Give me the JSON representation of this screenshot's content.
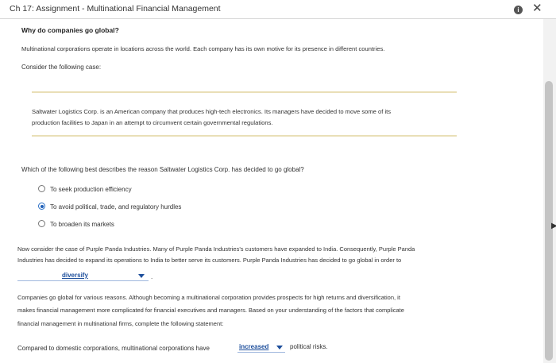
{
  "window": {
    "title": "Ch 17: Assignment - Multinational Financial Management"
  },
  "section": {
    "heading": "Why do companies go global?",
    "intro": "Multinational corporations operate in locations across the world. Each company has its own motive for its presence in different countries.",
    "consider": "Consider the following case:"
  },
  "case": {
    "line1": "Saltwater Logistics Corp. is an American company that produces high-tech electronics. Its managers have decided to move some of its",
    "line2": "production facilities to Japan in an attempt to circumvent certain governmental regulations."
  },
  "question1": {
    "prompt": "Which of the following best describes the reason Saltwater Logistics Corp. has decided to go global?",
    "options": [
      {
        "label": "To seek production efficiency",
        "selected": false
      },
      {
        "label": "To avoid political, trade, and regulatory hurdles",
        "selected": true
      },
      {
        "label": "To broaden its markets",
        "selected": false
      }
    ]
  },
  "question2": {
    "line1": "Now consider the case of Purple Panda Industries. Many of Purple Panda Industries's customers have expanded to India. Consequently, Purple Panda",
    "line2": "Industries has decided to expand its operations to India to better serve its customers. Purple Panda Industries has decided to go global in order to",
    "dropdown_value": "diversify",
    "end": "."
  },
  "question3": {
    "line1": "Companies go global for various reasons. Although becoming a multinational corporation provides prospects for high returns and diversification, it",
    "line2": "makes financial management more complicated for financial executives and managers. Based on your understanding of the factors that complicate",
    "line3": "financial management in multinational firms, complete the following statement:",
    "statement_before": "Compared to domestic corporations, multinational corporations have",
    "dropdown_value": "increased",
    "statement_after": "political risks."
  }
}
